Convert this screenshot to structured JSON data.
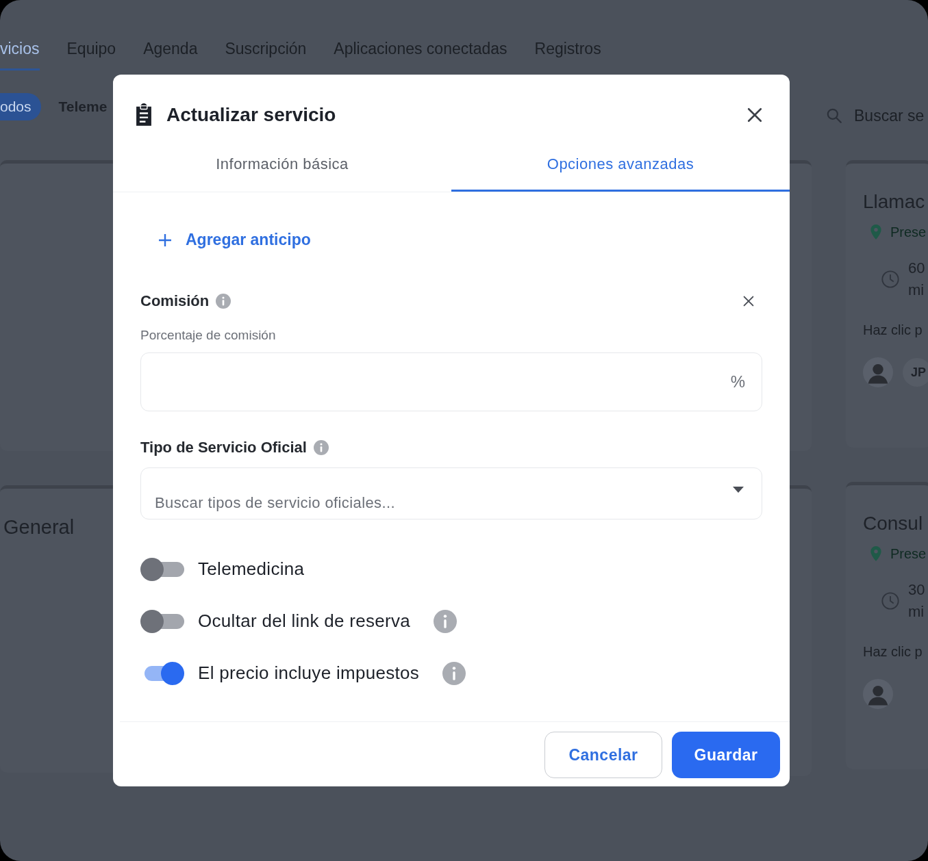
{
  "page": {
    "tabs": [
      {
        "label": "vicios",
        "selected": true
      },
      {
        "label": "Equipo",
        "selected": false
      },
      {
        "label": "Agenda",
        "selected": false
      },
      {
        "label": "Suscripción",
        "selected": false
      },
      {
        "label": "Aplicaciones conectadas",
        "selected": false
      },
      {
        "label": "Registros",
        "selected": false
      }
    ],
    "filters": [
      {
        "label": "odos",
        "selected": true
      },
      {
        "label": "Teleme",
        "selected": false
      }
    ],
    "search": {
      "placeholder": "Buscar se"
    },
    "left_cards": [
      {
        "title": "General"
      }
    ],
    "right_cards": [
      {
        "title": "Llamac",
        "location": "Prese",
        "duration_lines": [
          "60",
          "mi"
        ],
        "hint": "Haz clic p",
        "assignees": [
          {
            "kind": "photo"
          },
          {
            "kind": "initials",
            "text": "JP"
          }
        ]
      },
      {
        "title": "Consul",
        "location": "Prese",
        "duration_lines": [
          "30",
          "mi"
        ],
        "hint": "Haz clic p",
        "assignees": [
          {
            "kind": "photo"
          }
        ]
      }
    ]
  },
  "modal": {
    "title": "Actualizar servicio",
    "tabs": [
      {
        "label": "Información básica",
        "selected": false
      },
      {
        "label": "Opciones avanzadas",
        "selected": true
      }
    ],
    "add_link": "Agregar anticipo",
    "commission": {
      "title": "Comisión",
      "label": "Porcentaje de comisión",
      "suffix": "%"
    },
    "service_type": {
      "title": "Tipo de Servicio Oficial",
      "placeholder": "Buscar tipos de servicio oficiales..."
    },
    "toggles": [
      {
        "label": "Telemedicina",
        "on": false,
        "info": false
      },
      {
        "label": "Ocultar del link de reserva",
        "on": false,
        "info": true
      },
      {
        "label": "El precio incluye impuestos",
        "on": true,
        "info": true
      }
    ],
    "buttons": [
      {
        "label": "Cancelar",
        "kind": "secondary"
      },
      {
        "label": "Guardar",
        "kind": "primary"
      }
    ]
  }
}
